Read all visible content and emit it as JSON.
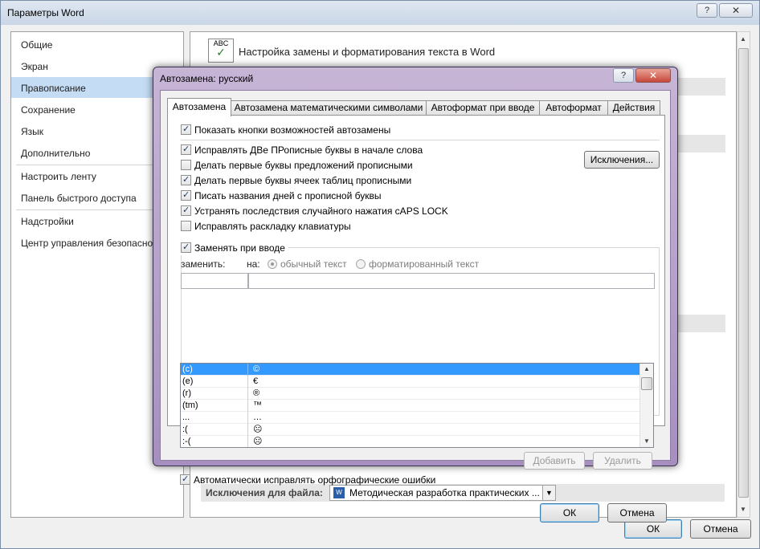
{
  "main_window": {
    "title": "Параметры Word",
    "help_glyph": "?",
    "close_glyph": "✕",
    "nav_items": [
      {
        "label": "Общие",
        "selected": false
      },
      {
        "label": "Экран",
        "selected": false
      },
      {
        "label": "Правописание",
        "selected": true
      },
      {
        "label": "Сохранение",
        "selected": false
      },
      {
        "label": "Язык",
        "selected": false
      },
      {
        "label": "Дополнительно",
        "selected": false
      },
      {
        "label": "Настроить ленту",
        "selected": false
      },
      {
        "label": "Панель быстрого доступа",
        "selected": false
      },
      {
        "label": "Надстройки",
        "selected": false
      },
      {
        "label": "Центр управления безопасностью",
        "selected": false
      }
    ],
    "content_header": "Настройка замены и форматирования текста в Word",
    "header_icon_text": "ABC",
    "exceptions_label": "Исключения для файла:",
    "file_name": "Методическая разработка практических ...",
    "file_icon_text": "W",
    "ok_label": "ОК",
    "cancel_label": "Отмена"
  },
  "dialog": {
    "title": "Автозамена: русский",
    "help_glyph": "?",
    "close_glyph": "✕",
    "tabs": [
      {
        "label": "Автозамена",
        "active": true
      },
      {
        "label": "Автозамена математическими символами",
        "active": false
      },
      {
        "label": "Автоформат при вводе",
        "active": false
      },
      {
        "label": "Автоформат",
        "active": false
      },
      {
        "label": "Действия",
        "active": false
      }
    ],
    "show_buttons_label": "Показать кнопки возможностей автозамены",
    "options": [
      {
        "label": "Исправлять ДВе ПРописные буквы в начале слова",
        "checked": true
      },
      {
        "label": "Делать первые буквы предложений прописными",
        "checked": false
      },
      {
        "label": "Делать первые буквы ячеек таблиц прописными",
        "checked": true
      },
      {
        "label": "Писать названия дней с прописной буквы",
        "checked": true
      },
      {
        "label": "Устранять последствия случайного нажатия cAPS LOCK",
        "checked": true
      },
      {
        "label": "Исправлять раскладку клавиатуры",
        "checked": false
      }
    ],
    "exceptions_button": "Исключения...",
    "replace_on_type_label": "Заменять при вводе",
    "replace_label": "заменить:",
    "with_label": "на:",
    "radio_plain": "обычный текст",
    "radio_formatted": "форматированный текст",
    "replace_value": "",
    "with_value": "",
    "entries": [
      {
        "from": "(c)",
        "to": "©",
        "selected": true
      },
      {
        "from": "(e)",
        "to": "€",
        "selected": false
      },
      {
        "from": "(r)",
        "to": "®",
        "selected": false
      },
      {
        "from": "(tm)",
        "to": "™",
        "selected": false
      },
      {
        "from": "...",
        "to": "…",
        "selected": false
      },
      {
        "from": ":(",
        "to": "☹",
        "selected": false
      },
      {
        "from": ":-(",
        "to": "☹",
        "selected": false
      }
    ],
    "add_button": "Добавить",
    "delete_button": "Удалить",
    "auto_spell_label": "Автоматически исправлять орфографические ошибки",
    "ok_label": "ОК",
    "cancel_label": "Отмена"
  }
}
